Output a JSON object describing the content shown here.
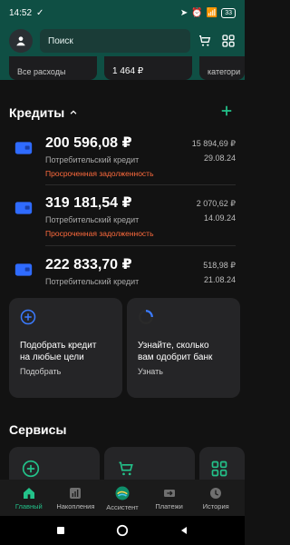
{
  "status": {
    "time": "14:52",
    "battery": "33"
  },
  "header": {
    "search_placeholder": "Поиск"
  },
  "summary": {
    "item1": "Все расходы",
    "item2": "1 464 ₽",
    "item3": "категори"
  },
  "credits": {
    "title": "Кредиты",
    "items": [
      {
        "amount": "200 596,08 ₽",
        "type": "Потребительский кредит",
        "overdue": "Просроченная задолженность",
        "small_amount": "15 894,69 ₽",
        "date": "29.08.24"
      },
      {
        "amount": "319 181,54 ₽",
        "type": "Потребительский кредит",
        "overdue": "Просроченная задолженность",
        "small_amount": "2 070,62 ₽",
        "date": "14.09.24"
      },
      {
        "amount": "222 833,70 ₽",
        "type": "Потребительский кредит",
        "overdue": "",
        "small_amount": "518,98 ₽",
        "date": "21.08.24"
      }
    ]
  },
  "promos": [
    {
      "title_line1": "Подобрать кредит",
      "title_line2": "на любые цели",
      "link": "Подобрать"
    },
    {
      "title_line1": "Узнайте, сколько",
      "title_line2": "вам одобрит банк",
      "link": "Узнать"
    }
  ],
  "services": {
    "title": "Сервисы"
  },
  "bottom_nav": {
    "items": [
      {
        "label": "Главный",
        "active": true
      },
      {
        "label": "Накопления",
        "active": false
      },
      {
        "label": "Ассистент",
        "active": false
      },
      {
        "label": "Платежи",
        "active": false
      },
      {
        "label": "История",
        "active": false
      }
    ]
  },
  "colors": {
    "accent_green": "#23c28a",
    "overdue_orange": "#ff6b3d",
    "card_blue": "#2f6bff",
    "header_teal": "#0f4f44"
  }
}
